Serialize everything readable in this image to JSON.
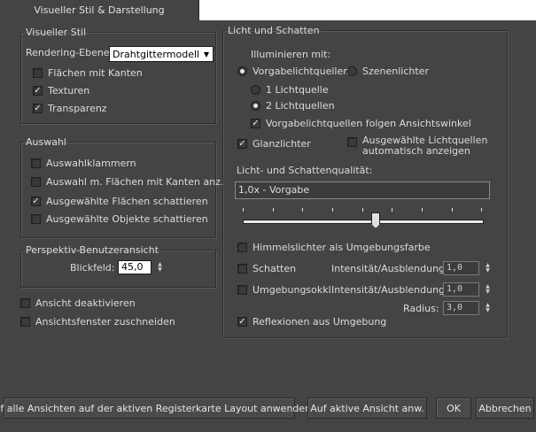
{
  "tab": {
    "label": "Visueller Stil & Darstellung"
  },
  "visual_style": {
    "legend": "Visueller Stil",
    "rendering_label": "Rendering-Ebene:",
    "rendering_value": "Drahtgittermodell",
    "options": [
      {
        "label": "Flächen mit Kanten",
        "checked": false
      },
      {
        "label": "Texturen",
        "checked": true
      },
      {
        "label": "Transparenz",
        "checked": true
      }
    ]
  },
  "selection": {
    "legend": "Auswahl",
    "options": [
      {
        "label": "Auswahlklammern",
        "checked": false
      },
      {
        "label": "Auswahl m. Flächen mit Kanten anz.",
        "checked": false
      },
      {
        "label": "Ausgewählte Flächen schattieren",
        "checked": true
      },
      {
        "label": "Ausgewählte Objekte schattieren",
        "checked": false
      }
    ]
  },
  "perspective": {
    "legend": "Perspektiv-Benutzeransicht",
    "fov_label": "Blickfeld:",
    "fov_value": "45,0"
  },
  "view_options": [
    {
      "label": "Ansicht deaktivieren",
      "checked": false
    },
    {
      "label": "Ansichtsfenster zuschneiden",
      "checked": false
    }
  ],
  "lighting": {
    "legend": "Licht und Schatten",
    "illuminate_label": "Illuminieren mit:",
    "radio_default": "Vorgabelichtquellen",
    "radio_scene": "Szenenlichter",
    "radio_one": "1 Lichtquelle",
    "radio_two": "2 Lichtquellen",
    "follow_view": "Vorgabelichtquellen folgen Ansichtswinkel",
    "follow_view_checked": true,
    "highlights": "Glanzlichter",
    "highlights_checked": true,
    "auto_show_line1": "Ausgewählte Lichtquellen",
    "auto_show_line2": "automatisch anzeigen",
    "auto_show_checked": false,
    "quality_label": "Licht- und Schattenqualität:",
    "quality_value": "1,0x - Vorgabe",
    "quality_slider_fraction": 0.54,
    "sky_lights": "Himmelslichter als Umgebungsfarbe",
    "shadows": "Schatten",
    "ambient_occlusion": "Umgebungsokkl.",
    "intensity_label": "Intensität/Ausblendung:",
    "intensity_shadows": "1,0",
    "intensity_ao": "1,0",
    "radius_label": "Radius:",
    "radius_value": "3,0",
    "reflections": "Reflexionen aus Umgebung",
    "reflections_checked": true
  },
  "buttons": {
    "apply_all": "Auf alle Ansichten auf der aktiven Registerkarte Layout anwenden",
    "apply_active": "Auf aktive Ansicht anw.",
    "ok": "OK",
    "cancel": "Abbrechen"
  },
  "check_mark": "✓"
}
